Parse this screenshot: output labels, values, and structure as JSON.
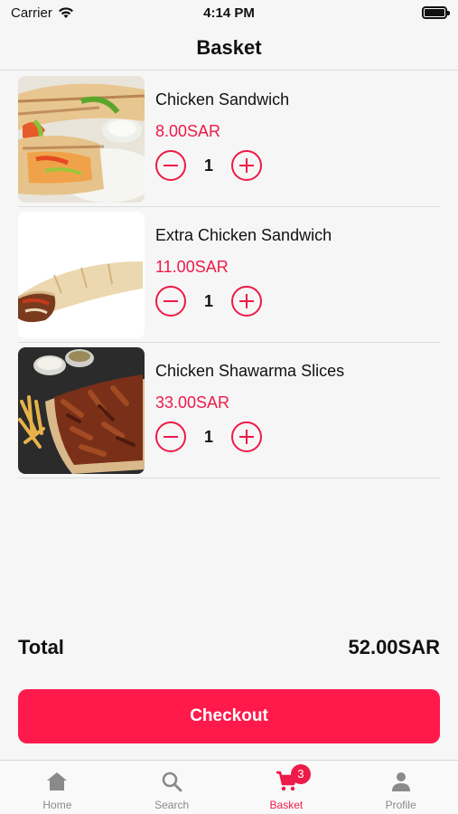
{
  "status_bar": {
    "carrier": "Carrier",
    "time": "4:14 PM",
    "battery_level": 1.0
  },
  "header": {
    "title": "Basket"
  },
  "basket": {
    "items": [
      {
        "name": "Chicken Sandwich",
        "price": "8.00SAR",
        "quantity": "1",
        "image": "chicken-sandwich-wrap"
      },
      {
        "name": "Extra Chicken Sandwich",
        "price": "11.00SAR",
        "quantity": "1",
        "image": "extra-chicken-wrap"
      },
      {
        "name": "Chicken Shawarma Slices",
        "price": "33.00SAR",
        "quantity": "1",
        "image": "shawarma-slices-plate"
      }
    ],
    "total_label": "Total",
    "total_value": "52.00SAR",
    "checkout_label": "Checkout"
  },
  "tabs": [
    {
      "label": "Home",
      "icon": "home-icon",
      "active": false
    },
    {
      "label": "Search",
      "icon": "search-icon",
      "active": false
    },
    {
      "label": "Basket",
      "icon": "cart-icon",
      "active": true,
      "badge": "3"
    },
    {
      "label": "Profile",
      "icon": "person-icon",
      "active": false
    }
  ],
  "colors": {
    "accent": "#ee1a48",
    "checkout": "#ff1a4b",
    "background": "#f6f6f6",
    "tab_inactive": "#8a8a8a"
  }
}
